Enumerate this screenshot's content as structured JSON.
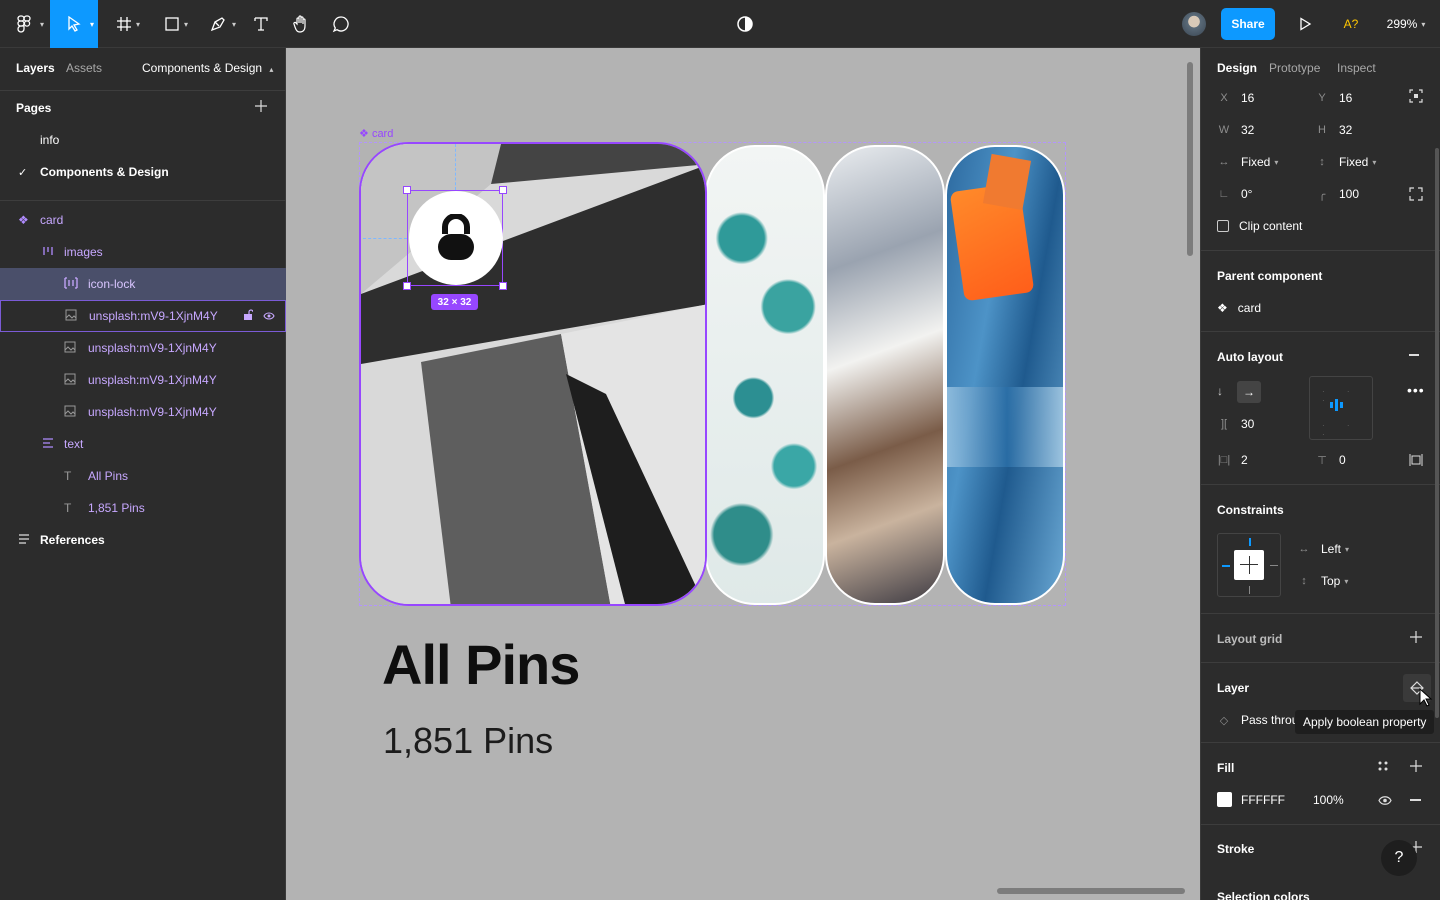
{
  "toolbar": {
    "share_label": "Share",
    "badge": "A?",
    "zoom": "299%"
  },
  "left_panel": {
    "tabs": [
      "Layers",
      "Assets"
    ],
    "page_selector": "Components & Design",
    "pages_title": "Pages",
    "pages": [
      "info",
      "Components & Design"
    ],
    "layers": [
      {
        "label": "card",
        "kind": "component"
      },
      {
        "label": "images",
        "kind": "autolayout"
      },
      {
        "label": "icon-lock",
        "kind": "instance"
      },
      {
        "label": "unsplash:mV9-1XjnM4Y",
        "kind": "image"
      },
      {
        "label": "unsplash:mV9-1XjnM4Y",
        "kind": "image"
      },
      {
        "label": "unsplash:mV9-1XjnM4Y",
        "kind": "image"
      },
      {
        "label": "unsplash:mV9-1XjnM4Y",
        "kind": "image"
      },
      {
        "label": "text",
        "kind": "autolayout"
      },
      {
        "label": "All Pins",
        "kind": "text"
      },
      {
        "label": "1,851 Pins",
        "kind": "text"
      },
      {
        "label": "References",
        "kind": "section"
      }
    ]
  },
  "canvas": {
    "frame_label": "card",
    "size_badge": "32 × 32",
    "title": "All Pins",
    "subtitle": "1,851 Pins"
  },
  "right_panel": {
    "tabs": [
      "Design",
      "Prototype",
      "Inspect"
    ],
    "x": "16",
    "y": "16",
    "w": "32",
    "h": "32",
    "x_label": "X",
    "y_label": "Y",
    "w_label": "W",
    "h_label": "H",
    "width_mode": "Fixed",
    "height_mode": "Fixed",
    "rotation": "0°",
    "radius": "100",
    "clip_content": "Clip content",
    "parent_component_title": "Parent component",
    "parent_component": "card",
    "auto_layout_title": "Auto layout",
    "spacing": "30",
    "padding_h": "2",
    "padding_v": "0",
    "constraints_title": "Constraints",
    "constraint_h": "Left",
    "constraint_v": "Top",
    "layout_grid_title": "Layout grid",
    "layer_title": "Layer",
    "layer_blend": "Pass throu",
    "tooltip": "Apply boolean property",
    "fill_title": "Fill",
    "fill_hex": "FFFFFF",
    "fill_opacity": "100%",
    "stroke_title": "Stroke",
    "selection_colors_title": "Selection colors"
  },
  "colors": {
    "accent": "#0d99ff",
    "selection": "#9747ff",
    "panel": "#2c2c2c",
    "canvas": "#b3b3b3",
    "badge": "#ffc700"
  }
}
